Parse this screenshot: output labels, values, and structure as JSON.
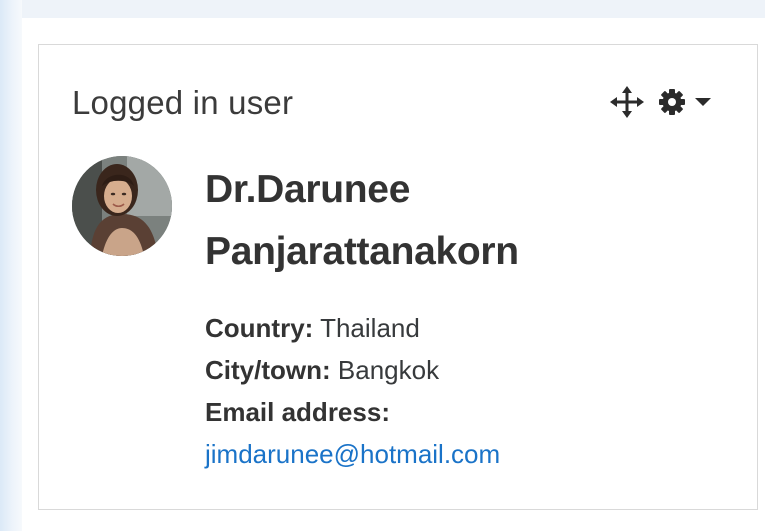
{
  "block": {
    "title": "Logged in user",
    "controls": {
      "move_icon": "move-arrows-icon",
      "settings_icon": "gear-icon",
      "menu_icon": "caret-down-icon"
    }
  },
  "user": {
    "name": "Dr.Darunee Panjarattanakorn",
    "fields": {
      "country_label": "Country:",
      "country_value": "Thailand",
      "city_label": "City/town:",
      "city_value": "Bangkok",
      "email_label": "Email address:",
      "email_value": "jimdarunee@hotmail.com"
    }
  },
  "colors": {
    "link": "#1a73c8",
    "text": "#333333",
    "border": "#d9d9d9",
    "page_background": "#eef3f9"
  }
}
